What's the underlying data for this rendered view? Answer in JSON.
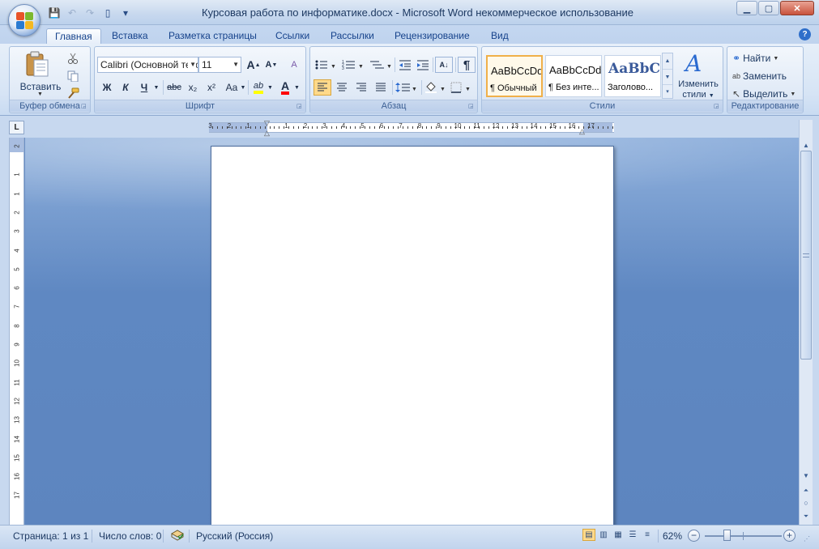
{
  "window": {
    "title": "Курсовая работа по информатике.docx - Microsoft Word некоммерческое использование",
    "minimize": "▁",
    "maximize": "▢",
    "close": "✕"
  },
  "qat": {
    "save": "💾",
    "undo": "↶",
    "redo": "↷",
    "new": "▯",
    "customize": "▾"
  },
  "tabs": [
    "Главная",
    "Вставка",
    "Разметка страницы",
    "Ссылки",
    "Рассылки",
    "Рецензирование",
    "Вид"
  ],
  "help": "?",
  "ribbon": {
    "clipboard": {
      "label": "Буфер обмена",
      "paste": "Вставить",
      "cut_icon": "scissors-icon",
      "copy_icon": "copy-icon",
      "painter_icon": "format-painter-icon"
    },
    "font": {
      "label": "Шрифт",
      "font_name": "Calibri (Основной текст)",
      "font_size": "11",
      "grow": "A",
      "shrink": "A",
      "clear": "A",
      "bold": "Ж",
      "italic": "К",
      "underline": "Ч",
      "strike": "abc",
      "sub": "x₂",
      "sup": "x²",
      "case": "Aa",
      "highlight": "ab",
      "color": "A",
      "highlight_color": "#ffff00",
      "font_color": "#ff0000"
    },
    "paragraph": {
      "label": "Абзац",
      "pilcrow": "¶",
      "sort": "A↓"
    },
    "styles": {
      "label": "Стили",
      "items": [
        {
          "sample": "AaBbCcDd",
          "name": "¶ Обычный"
        },
        {
          "sample": "AaBbCcDd",
          "name": "¶ Без инте..."
        },
        {
          "sample": "AaBbCc",
          "name": "Заголово..."
        }
      ],
      "change": "Изменить стили",
      "change_line1": "Изменить",
      "change_line2": "стили"
    },
    "editing": {
      "label": "Редактирование",
      "find": "Найти",
      "replace": "Заменить",
      "select": "Выделить"
    }
  },
  "ruler": {
    "tab_selector": "L",
    "h_numbers": [
      "3",
      "2",
      "1",
      "1",
      "2",
      "3",
      "4",
      "5",
      "6",
      "7",
      "8",
      "9",
      "10",
      "11",
      "12",
      "13",
      "14",
      "15",
      "16",
      "17"
    ],
    "v_numbers": [
      "2",
      "1",
      "1",
      "2",
      "3",
      "4",
      "5",
      "6",
      "7",
      "8",
      "9",
      "10",
      "11",
      "12",
      "13",
      "14",
      "15",
      "16",
      "17"
    ]
  },
  "status": {
    "page": "Страница: 1 из 1",
    "words": "Число слов: 0",
    "language": "Русский (Россия)",
    "zoom": "62%",
    "zoom_value": 62,
    "minus": "−",
    "plus": "+"
  }
}
